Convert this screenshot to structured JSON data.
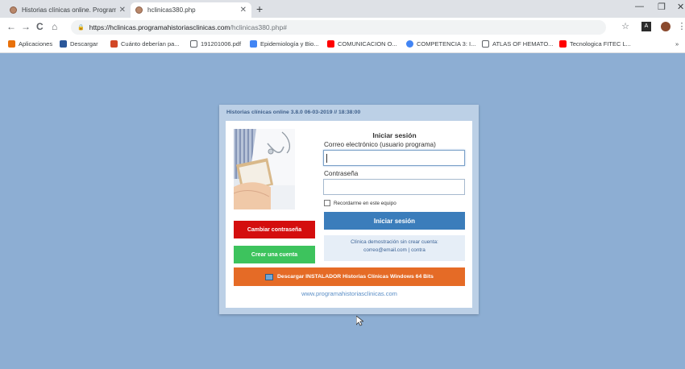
{
  "browser": {
    "tabs": [
      {
        "label": "Historias clínicas online. Program",
        "active": false
      },
      {
        "label": "hclinicas380.php",
        "active": true
      }
    ],
    "new_tab": "+",
    "window_controls": {
      "minimize": "—",
      "restore": "❐",
      "close": "✕"
    },
    "nav": {
      "back": "←",
      "forward": "→",
      "reload": "C",
      "home": "⌂"
    },
    "address": {
      "host": "https://hclinicas.programahistoriasclinicas.com",
      "path": "/hclinicas380.php#"
    },
    "bookmarks": [
      {
        "label": "Aplicaciones",
        "icon": "apps-grid-icon",
        "color": "#e8710a"
      },
      {
        "label": "Descargar",
        "icon": "word-icon",
        "color": "#2b579a"
      },
      {
        "label": "Cuánto deberían pa...",
        "icon": "powerpoint-icon",
        "color": "#d24726"
      },
      {
        "label": "191201006.pdf",
        "icon": "file-icon",
        "color": "#ffffff"
      },
      {
        "label": "Epidemiología y Bio...",
        "icon": "doc-icon",
        "color": "#4285f4"
      },
      {
        "label": "COMUNICACION O...",
        "icon": "youtube-icon",
        "color": "#ff0000"
      },
      {
        "label": "COMPETENCIA 3: I...",
        "icon": "globe-icon",
        "color": "#4285f4"
      },
      {
        "label": "ATLAS OF HEMATO...",
        "icon": "file-icon",
        "color": "#ffffff"
      },
      {
        "label": "Tecnologica FITEC L...",
        "icon": "youtube-icon",
        "color": "#ff0000"
      }
    ],
    "more_bookmarks": "»"
  },
  "app": {
    "title": "Historias clínicas online 3.8.0 06-03-2019 // 18:38:00",
    "login": {
      "heading": "Iniciar sesión",
      "email_label": "Correo electrónico (usuario programa)",
      "email_value": "",
      "password_label": "Contraseña",
      "password_value": "",
      "remember_label": "Recordarme en este equipo",
      "remember_checked": false,
      "submit_label": "Iniciar sesión"
    },
    "buttons": {
      "change_password": "Cambiar contraseña",
      "create_account": "Crear una cuenta",
      "download_installer": "Descargar INSTALADOR Historias Clínicas Windows 64 Bits"
    },
    "demo": {
      "line1": "Clínica demostración sin crear cuenta:",
      "line2": "correo@email.com |  contra"
    },
    "website": "www.programahistoriasclinicas.com"
  },
  "colors": {
    "page_bg": "#8daed3",
    "red_button": "#d40e0e",
    "green_button": "#3dc35d",
    "login_button": "#3b7dbb",
    "orange_button": "#e56b26"
  }
}
